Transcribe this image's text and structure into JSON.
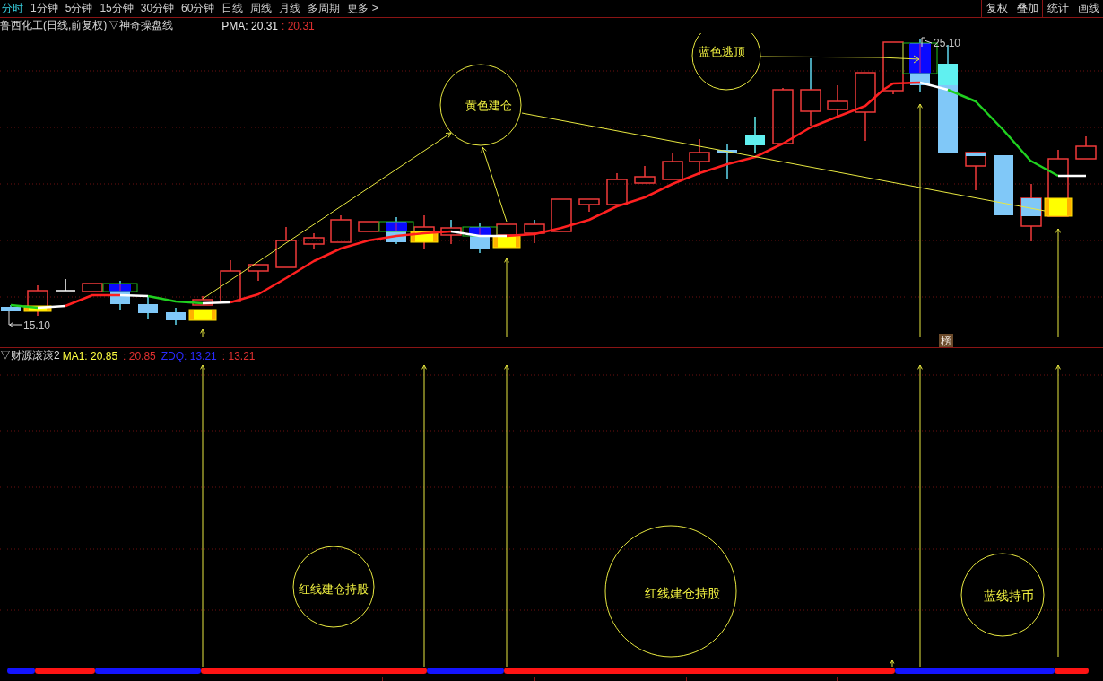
{
  "toolbar": {
    "tabs": [
      {
        "label": "分时",
        "selected": true
      },
      {
        "label": "1分钟",
        "selected": false
      },
      {
        "label": "5分钟",
        "selected": false
      },
      {
        "label": "15分钟",
        "selected": false
      },
      {
        "label": "30分钟",
        "selected": false
      },
      {
        "label": "60分钟",
        "selected": false
      },
      {
        "label": "日线",
        "selected": false
      },
      {
        "label": "周线",
        "selected": false
      },
      {
        "label": "月线",
        "selected": false
      },
      {
        "label": "多周期",
        "selected": false
      },
      {
        "label": "更多 >",
        "selected": false
      }
    ],
    "buttons": [
      "复权",
      "叠加",
      "统计",
      "画线"
    ]
  },
  "main_chart": {
    "title": "鲁西化工(日线,前复权)",
    "indicator": "▽神奇操盘线",
    "readings": [
      {
        "text": "PMA: 20.31",
        "color": "#e8e8e8"
      },
      {
        "text": ": 20.31",
        "color": "#e03030"
      }
    ],
    "annotations": [
      "黄色建仓",
      "蓝色逃顶"
    ],
    "price_labels": [
      "15.10",
      "25.10"
    ],
    "badge": "榜"
  },
  "sub_chart": {
    "indicator": "▽财源滚滚2",
    "readings": [
      {
        "text": "MA1: 20.85",
        "color": "#ffff40"
      },
      {
        "text": ": 20.85",
        "color": "#e03030"
      },
      {
        "text": "ZDQ: 13.21",
        "color": "#2a2aff"
      },
      {
        "text": ": 13.21",
        "color": "#e03030"
      }
    ],
    "annotations": [
      "红线建仓持股",
      "红线建仓持股",
      "蓝线持币"
    ]
  }
}
